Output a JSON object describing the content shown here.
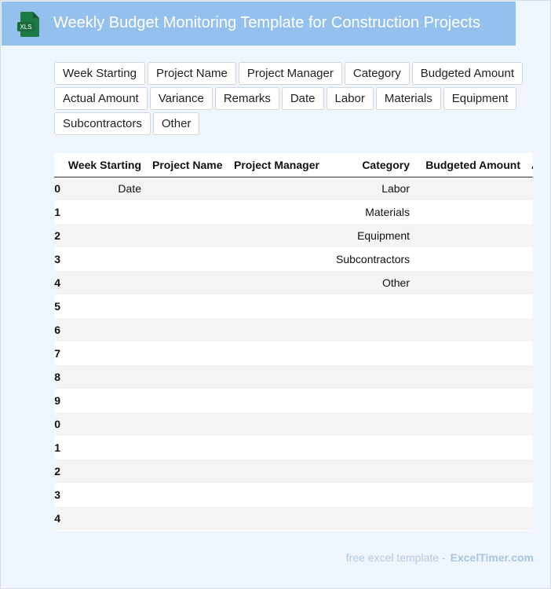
{
  "header": {
    "title": "Weekly Budget Monitoring Template for Construction Projects",
    "icon_label": "XLS",
    "icon_color": "#1e7a45",
    "background": "#93c0ec"
  },
  "chips": [
    "Week Starting",
    "Project Name",
    "Project Manager",
    "Category",
    "Budgeted Amount",
    "Actual Amount",
    "Variance",
    "Remarks",
    "Date",
    "Labor",
    "Materials",
    "Equipment",
    "Subcontractors",
    "Other"
  ],
  "table": {
    "columns": [
      "Week Starting",
      "Project Name",
      "Project Manager",
      "Category",
      "Budgeted Amount",
      "Ac"
    ],
    "rows": [
      {
        "index": "0",
        "week": "Date",
        "category": "Labor"
      },
      {
        "index": "1",
        "week": "",
        "category": "Materials"
      },
      {
        "index": "2",
        "week": "",
        "category": "Equipment"
      },
      {
        "index": "3",
        "week": "",
        "category": "Subcontractors"
      },
      {
        "index": "4",
        "week": "",
        "category": "Other"
      },
      {
        "index": "5",
        "week": "",
        "category": ""
      },
      {
        "index": "6",
        "week": "",
        "category": ""
      },
      {
        "index": "7",
        "week": "",
        "category": ""
      },
      {
        "index": "8",
        "week": "",
        "category": ""
      },
      {
        "index": "9",
        "week": "",
        "category": ""
      },
      {
        "index": "0",
        "week": "",
        "category": ""
      },
      {
        "index": "1",
        "week": "",
        "category": ""
      },
      {
        "index": "2",
        "week": "",
        "category": ""
      },
      {
        "index": "3",
        "week": "",
        "category": ""
      },
      {
        "index": "4",
        "week": "",
        "category": ""
      }
    ]
  },
  "footer": {
    "prefix": "free excel template -",
    "brand": "ExcelTimer.com"
  }
}
